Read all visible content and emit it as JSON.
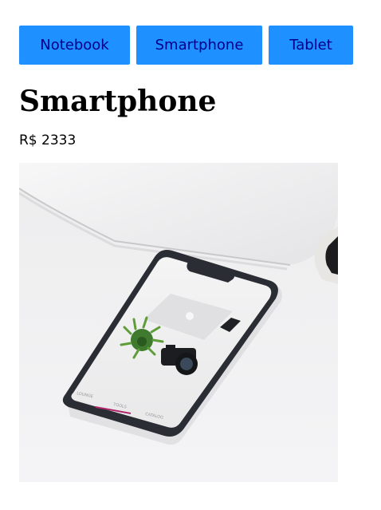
{
  "nav": {
    "items": [
      {
        "label": "Notebook"
      },
      {
        "label": "Smartphone"
      },
      {
        "label": "Tablet"
      }
    ]
  },
  "product": {
    "name": "Smartphone",
    "price": "R$ 2333",
    "image": {
      "description": "smartphone-photo",
      "screen_tabs": [
        "LOUNGE",
        "TOOLS",
        "CATALOG"
      ]
    }
  },
  "colors": {
    "button_bg": "#1e90ff",
    "button_text": "#00008b"
  }
}
